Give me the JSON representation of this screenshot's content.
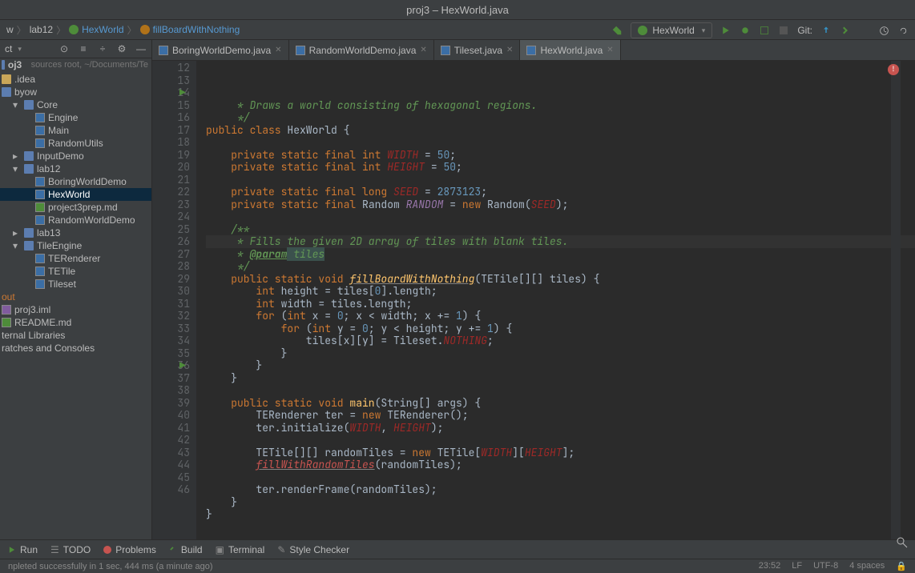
{
  "window": {
    "title": "proj3 – HexWorld.java"
  },
  "breadcrumbs": {
    "items": [
      "w",
      "lab12",
      "HexWorld",
      "fillBoardWithNothing"
    ]
  },
  "run_config": {
    "selected": "HexWorld"
  },
  "git_label": "Git:",
  "sidebar": {
    "root": "oj3",
    "root_hint": "sources root, ~/Documents/Te",
    "tree": [
      {
        "label": ".idea",
        "type": "folder",
        "indent": 0
      },
      {
        "label": "byow",
        "type": "folder-blue",
        "indent": 0
      },
      {
        "label": "Core",
        "type": "folder-blue",
        "indent": 1,
        "caret": "▾"
      },
      {
        "label": "Engine",
        "type": "java",
        "indent": 2
      },
      {
        "label": "Main",
        "type": "java",
        "indent": 2
      },
      {
        "label": "RandomUtils",
        "type": "java",
        "indent": 2
      },
      {
        "label": "InputDemo",
        "type": "folder-blue",
        "indent": 1,
        "caret": "▸"
      },
      {
        "label": "lab12",
        "type": "folder-blue",
        "indent": 1,
        "caret": "▾"
      },
      {
        "label": "BoringWorldDemo",
        "type": "java",
        "indent": 2
      },
      {
        "label": "HexWorld",
        "type": "java",
        "indent": 2,
        "selected": true
      },
      {
        "label": "project3prep.md",
        "type": "md",
        "indent": 2
      },
      {
        "label": "RandomWorldDemo",
        "type": "java",
        "indent": 2
      },
      {
        "label": "lab13",
        "type": "folder-blue",
        "indent": 1,
        "caret": "▸"
      },
      {
        "label": "TileEngine",
        "type": "folder-blue",
        "indent": 1,
        "caret": "▾"
      },
      {
        "label": "TERenderer",
        "type": "java",
        "indent": 2
      },
      {
        "label": "TETile",
        "type": "java",
        "indent": 2
      },
      {
        "label": "Tileset",
        "type": "java",
        "indent": 2
      },
      {
        "label": "out",
        "type": "orange",
        "indent": 0
      },
      {
        "label": "proj3.iml",
        "type": "iml",
        "indent": 0
      },
      {
        "label": "README.md",
        "type": "md",
        "indent": 0
      },
      {
        "label": "ternal Libraries",
        "type": "plain",
        "indent": 0
      },
      {
        "label": "ratches and Consoles",
        "type": "plain",
        "indent": 0
      }
    ]
  },
  "tabs": [
    {
      "label": "BoringWorldDemo.java"
    },
    {
      "label": "RandomWorldDemo.java"
    },
    {
      "label": "Tileset.java"
    },
    {
      "label": "HexWorld.java",
      "active": true
    }
  ],
  "gutter": {
    "start": 12,
    "end": 46,
    "run_lines": [
      14,
      36
    ],
    "current_line": 23
  },
  "code": {
    "l12": " * Draws a world consisting of hexagonal regions.",
    "l13": " */",
    "l14_a": "public class ",
    "l14_b": "HexWorld {",
    "l16_a": "private static final int ",
    "l16_w": "WIDTH",
    "l16_b": " = ",
    "l16_n": "50",
    "l16_c": ";",
    "l17_a": "private static final int ",
    "l17_w": "HEIGHT",
    "l17_b": " = ",
    "l17_n": "50",
    "l17_c": ";",
    "l19_a": "private static final long ",
    "l19_w": "SEED",
    "l19_b": " = ",
    "l19_n": "2873123",
    "l19_c": ";",
    "l20_a": "private static final ",
    "l20_t": "Random ",
    "l20_w": "RANDOM",
    "l20_b": " = ",
    "l20_k": "new ",
    "l20_t2": "Random(",
    "l20_w2": "SEED",
    "l20_c": ");",
    "l22": "/**",
    "l23": " * Fills the given 2D array of tiles with blank tiles.",
    "l24_a": " * ",
    "l24_b": "@param",
    "l24_c": " tiles",
    "l25": " */",
    "l26_a": "public static void ",
    "l26_m": "fillBoardWithNothing",
    "l26_b": "(TETile[][] tiles) {",
    "l27_a": "int ",
    "l27_b": "height = tiles[",
    "l27_n": "0",
    "l27_c": "].length;",
    "l28_a": "int ",
    "l28_b": "width = tiles.length;",
    "l29_a": "for ",
    "l29_b": "(",
    "l29_c": "int ",
    "l29_d": "x = ",
    "l29_n1": "0",
    "l29_e": "; x < width; x += ",
    "l29_n2": "1",
    "l29_f": ") {",
    "l30_a": "for ",
    "l30_b": "(",
    "l30_c": "int ",
    "l30_d": "y = ",
    "l30_n1": "0",
    "l30_e": "; y < height; y += ",
    "l30_n2": "1",
    "l30_f": ") {",
    "l31_a": "tiles[x][y] = Tileset.",
    "l31_w": "NOTHING",
    "l31_b": ";",
    "l36_a": "public static void ",
    "l36_m": "main",
    "l36_b": "(String[] args) {",
    "l37_a": "TERenderer ter = ",
    "l37_k": "new ",
    "l37_b": "TERenderer();",
    "l38_a": "ter.initialize(",
    "l38_w1": "WIDTH",
    "l38_b": ", ",
    "l38_w2": "HEIGHT",
    "l38_c": ");",
    "l40_a": "TETile[][] randomTiles = ",
    "l40_k": "new ",
    "l40_b": "TETile[",
    "l40_w1": "WIDTH",
    "l40_c": "][",
    "l40_w2": "HEIGHT",
    "l40_d": "];",
    "l41_m": "fillWithRandomTiles",
    "l41_a": "(randomTiles);",
    "l43": "ter.renderFrame(randomTiles);"
  },
  "bottom_tabs": [
    "Run",
    "TODO",
    "Problems",
    "Build",
    "Terminal",
    "Style Checker"
  ],
  "status": {
    "left": "npleted successfully in 1 sec, 444 ms (a minute ago)",
    "cursor": "23:52",
    "sep": "LF",
    "enc": "UTF-8",
    "indent": "4 spaces"
  }
}
